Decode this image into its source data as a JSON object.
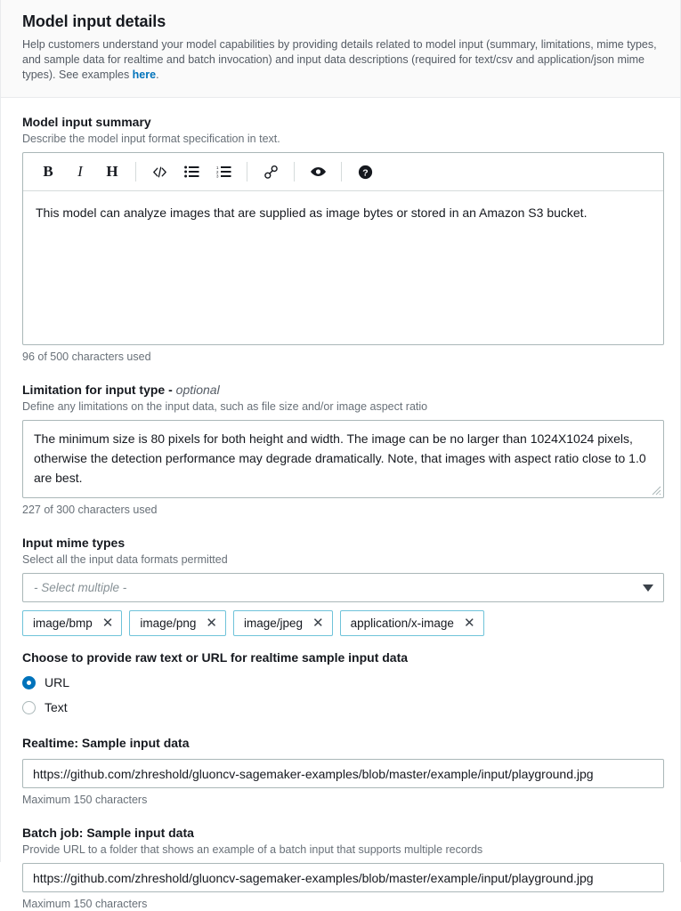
{
  "header": {
    "title": "Model input details",
    "description_part1": "Help customers understand your model capabilities by providing details related to model input (summary, limitations, mime types, and sample data for realtime and batch invocation) and input data descriptions (required for text/csv and application/json mime types). See examples ",
    "link_text": "here",
    "description_part2": "."
  },
  "model_input_summary": {
    "label": "Model input summary",
    "hint": "Describe the model input format specification in text.",
    "toolbar": {
      "bold": "B",
      "italic": "I",
      "heading": "H",
      "code_icon": "code-icon",
      "bullet_list_icon": "bullet-list-icon",
      "numbered_list_icon": "numbered-list-icon",
      "link_icon": "link-icon",
      "preview_icon": "eye-preview-icon",
      "help_icon": "help-circle-icon"
    },
    "value": "This model can analyze images that are supplied as image bytes or stored in an Amazon S3 bucket.",
    "counter": "96 of 500 characters used"
  },
  "limitation": {
    "label": "Limitation for input type - ",
    "label_optional": "optional",
    "hint": "Define any limitations on the input data, such as file size and/or image aspect ratio",
    "value": "The minimum size is 80 pixels for both height and width. The image can be no larger than 1024X1024 pixels, otherwise the detection performance may degrade dramatically. Note, that images with aspect ratio close to 1.0 are best.",
    "counter": "227 of 300 characters used"
  },
  "mime_types": {
    "label": "Input mime types",
    "hint": "Select all the input data formats permitted",
    "placeholder": "- Select multiple -",
    "caret_icon": "chevron-down-icon",
    "selected": [
      {
        "label": "image/bmp",
        "remove_icon": "✕"
      },
      {
        "label": "image/png",
        "remove_icon": "✕"
      },
      {
        "label": "image/jpeg",
        "remove_icon": "✕"
      },
      {
        "label": "application/x-image",
        "remove_icon": "✕"
      }
    ]
  },
  "input_source_choice": {
    "label": "Choose to provide raw text or URL for realtime sample input data",
    "options": [
      {
        "label": "URL",
        "selected": true
      },
      {
        "label": "Text",
        "selected": false
      }
    ]
  },
  "realtime_sample": {
    "label": "Realtime: Sample input data",
    "value": "https://github.com/zhreshold/gluoncv-sagemaker-examples/blob/master/example/input/playground.jpg",
    "footnote": "Maximum 150 characters"
  },
  "batch_sample": {
    "label": "Batch job: Sample input data",
    "hint": "Provide URL to a folder that shows an example of a batch input that supports multiple records",
    "value": "https://github.com/zhreshold/gluoncv-sagemaker-examples/blob/master/example/input/playground.jpg",
    "footnote": "Maximum 150 characters"
  },
  "colors": {
    "link": "#0073bb",
    "radio_selected": "#0073bb",
    "token_border": "#6fc3d9",
    "border": "#aab7b8",
    "header_bg": "#fafafa"
  }
}
